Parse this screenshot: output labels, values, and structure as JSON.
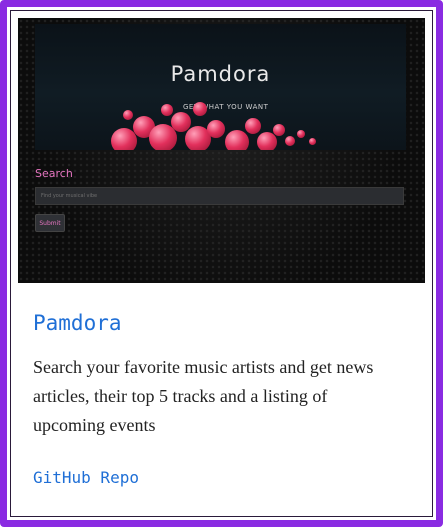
{
  "colors": {
    "card_border": "#8a2be2",
    "accent_link": "#1f6fd6",
    "search_accent": "#e575c0"
  },
  "preview": {
    "hero_title": "Pamdora",
    "hero_tagline": "GET WHAT YOU WANT",
    "search_label": "Search",
    "search_placeholder": "Find your musical vibe",
    "search_value": "",
    "submit_label": "Submit"
  },
  "project": {
    "title": "Pamdora",
    "description": "Search your favorite music artists and get news articles, their top 5 tracks and a listing of upcoming events",
    "repo_label": "GitHub Repo"
  }
}
